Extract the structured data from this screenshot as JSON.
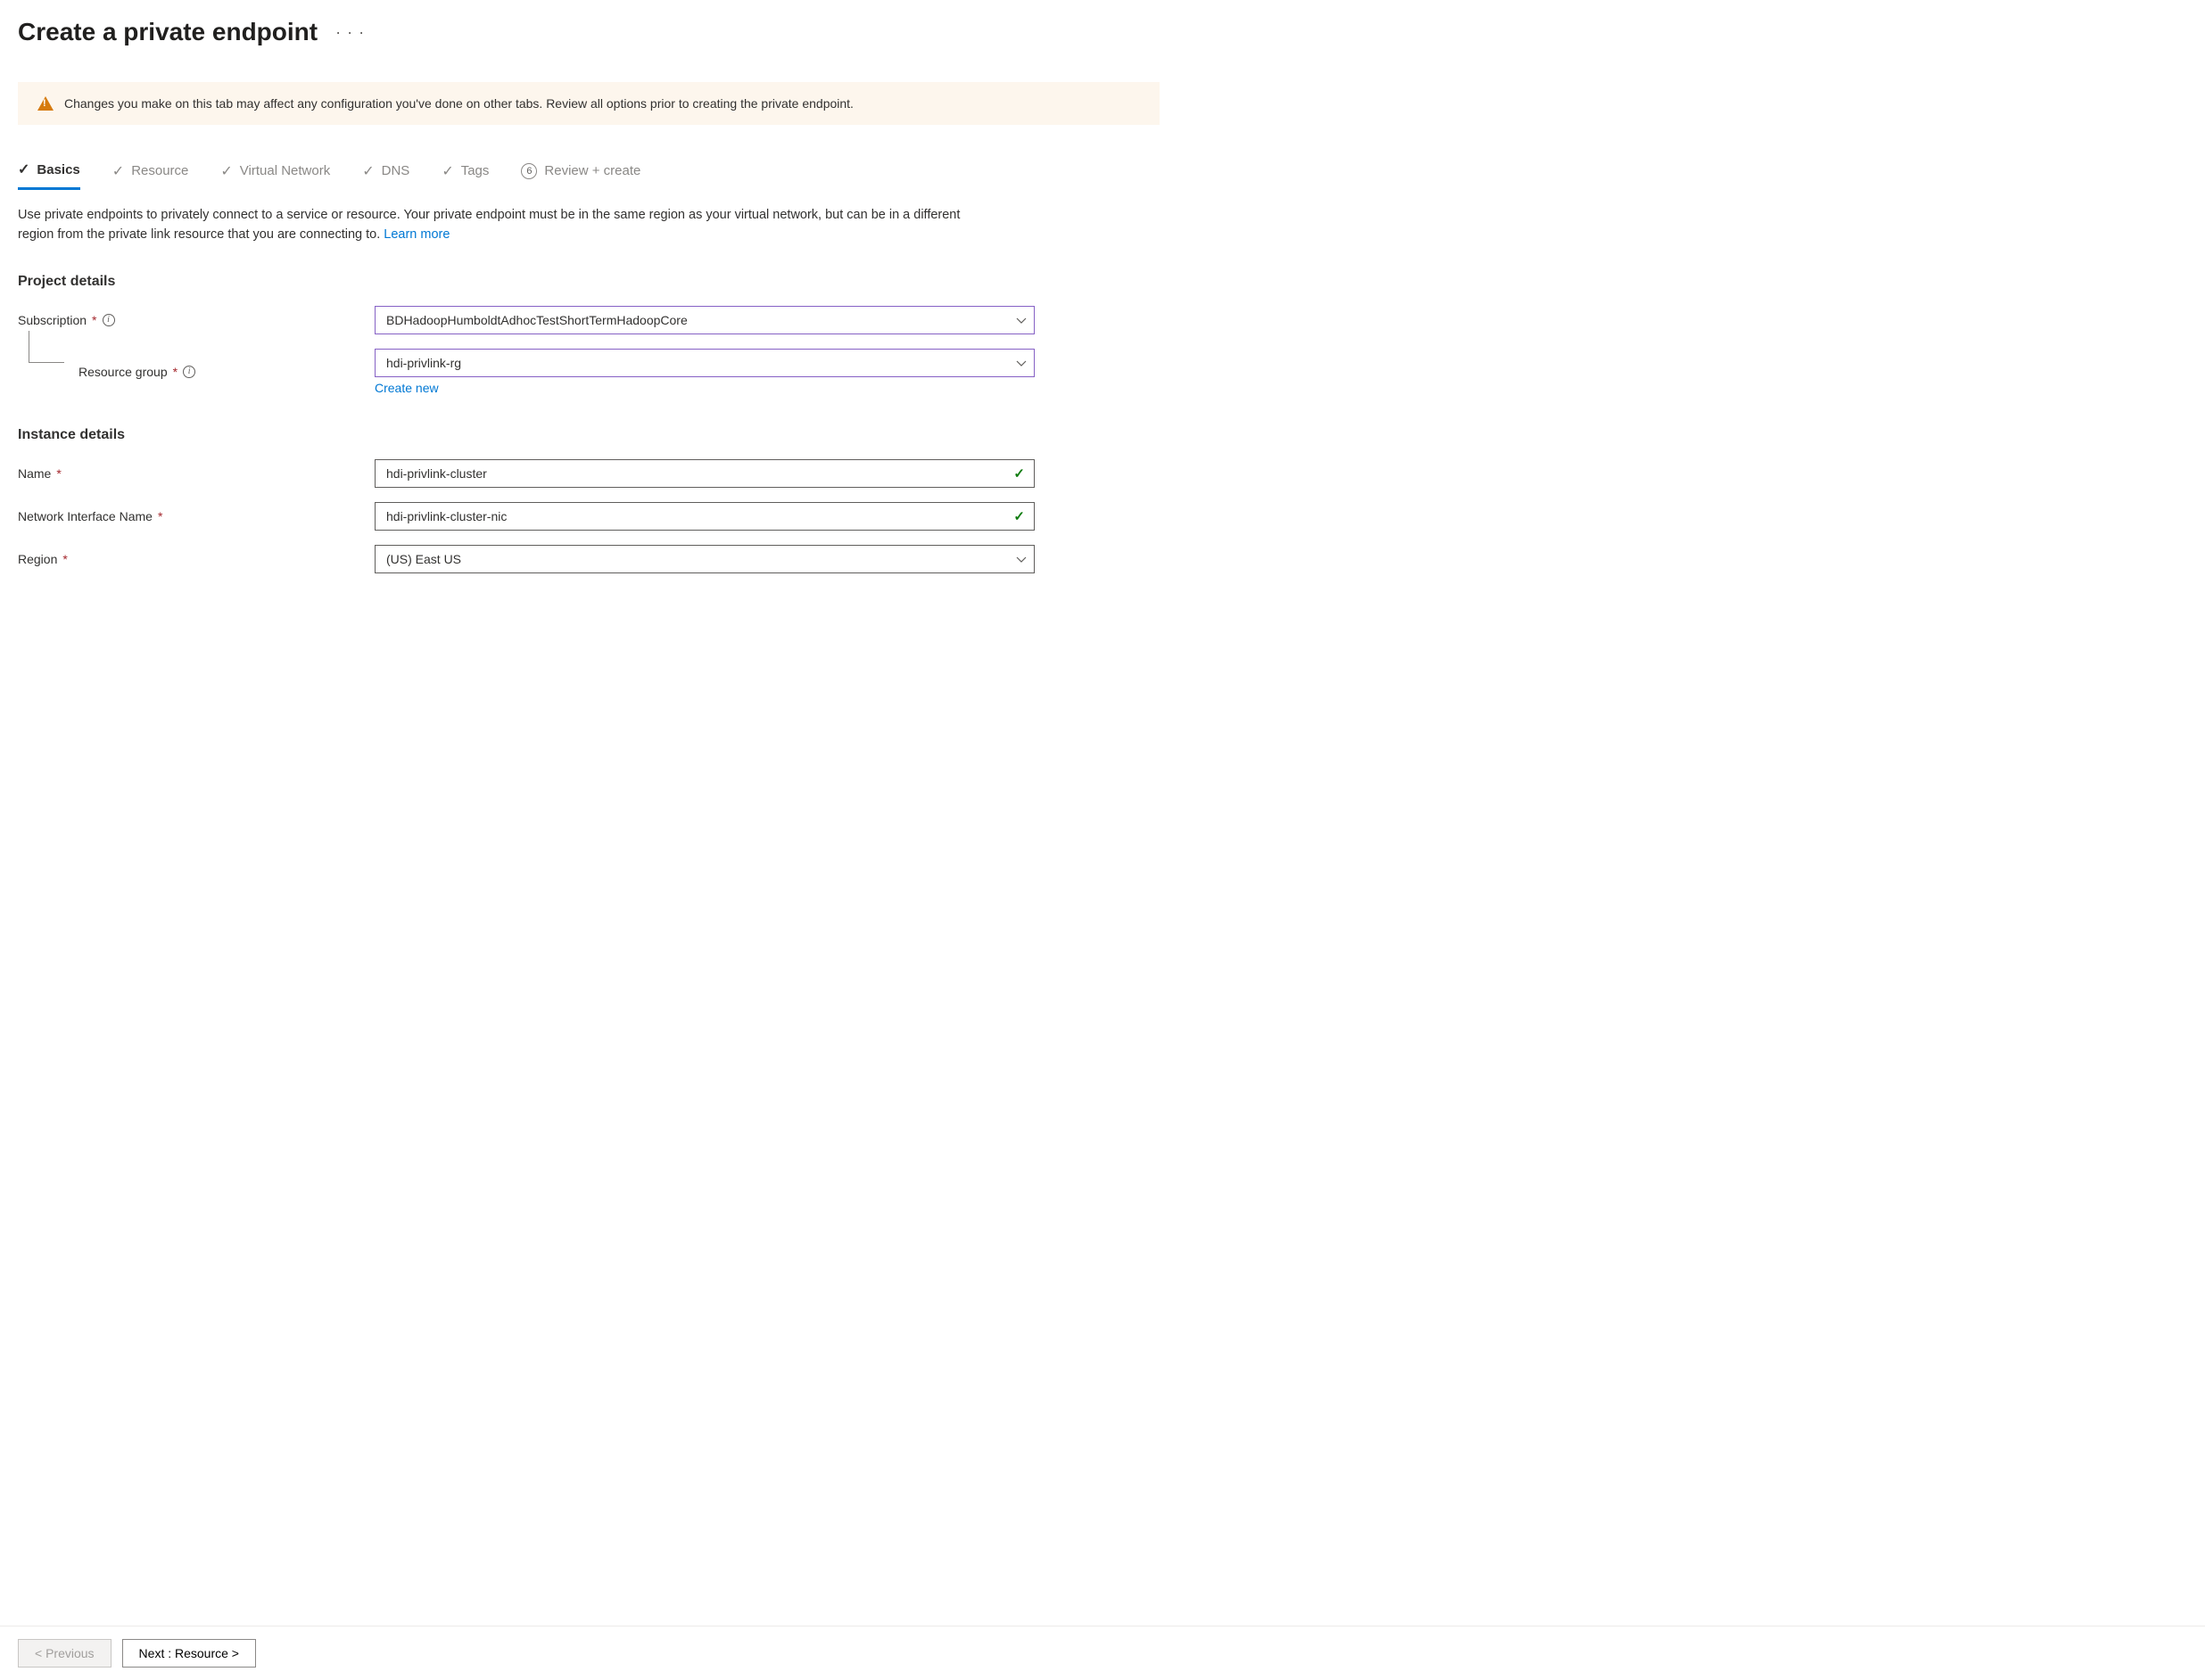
{
  "header": {
    "title": "Create a private endpoint"
  },
  "warning": {
    "text": "Changes you make on this tab may affect any configuration you've done on other tabs. Review all options prior to creating the private endpoint."
  },
  "tabs": {
    "basics": "Basics",
    "resource": "Resource",
    "vnet": "Virtual Network",
    "dns": "DNS",
    "tags": "Tags",
    "review": "Review + create",
    "review_number": "6"
  },
  "intro": {
    "text": "Use private endpoints to privately connect to a service or resource. Your private endpoint must be in the same region as your virtual network, but can be in a different region from the private link resource that you are connecting to.  ",
    "learn_more": "Learn more"
  },
  "sections": {
    "project": "Project details",
    "instance": "Instance details"
  },
  "labels": {
    "subscription": "Subscription",
    "resource_group": "Resource group",
    "name": "Name",
    "nic_name": "Network Interface Name",
    "region": "Region"
  },
  "values": {
    "subscription": "BDHadoopHumboldtAdhocTestShortTermHadoopCore",
    "resource_group": "hdi-privlink-rg",
    "create_new": "Create new",
    "name": "hdi-privlink-cluster",
    "nic_name": "hdi-privlink-cluster-nic",
    "region": "(US) East US"
  },
  "footer": {
    "previous": "< Previous",
    "next": "Next : Resource >"
  }
}
